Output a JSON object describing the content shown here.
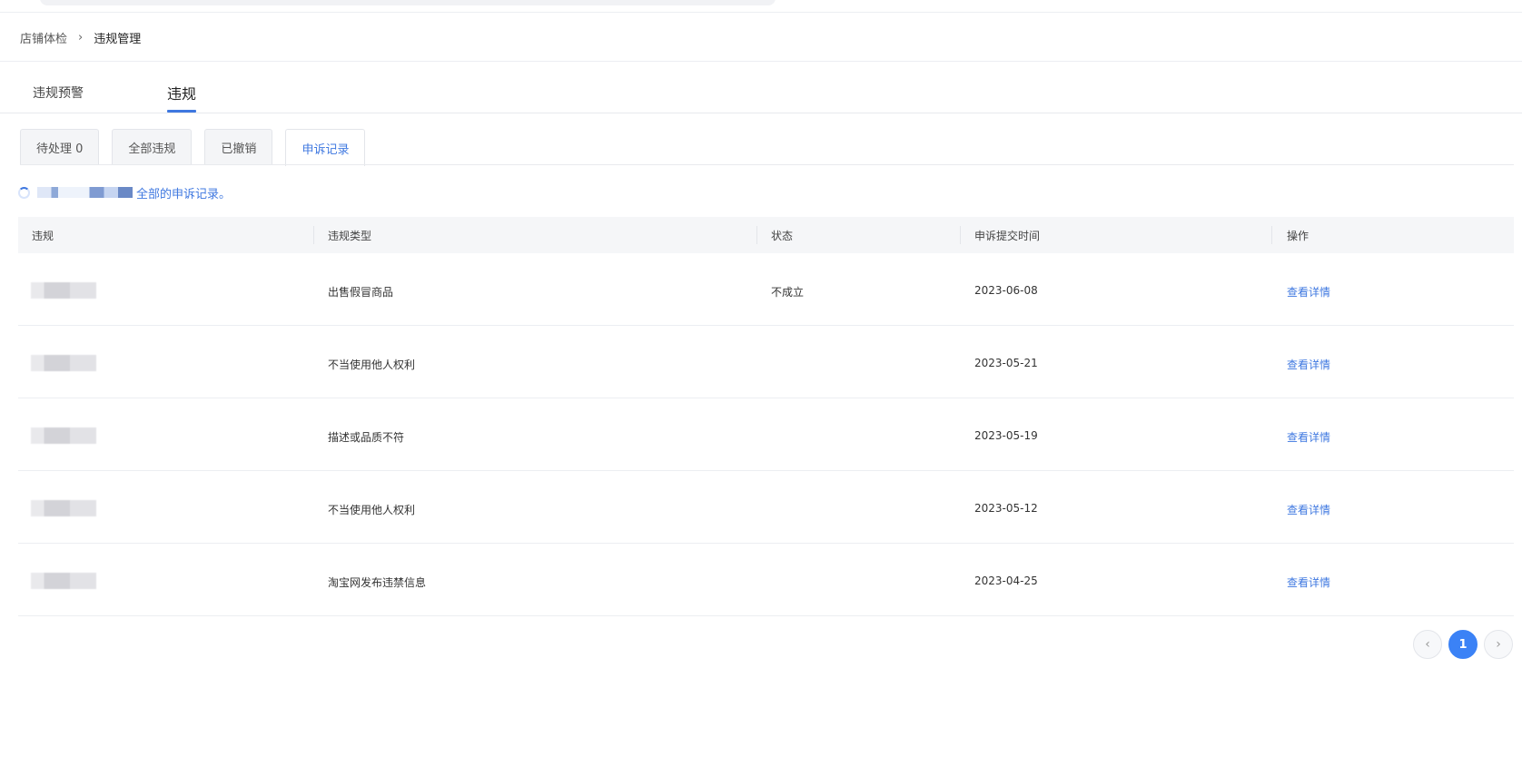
{
  "breadcrumb": {
    "parent": "店铺体检",
    "separator": "›",
    "current": "违规管理"
  },
  "main_tabs": [
    {
      "label": "违规预警"
    },
    {
      "label": "违规"
    }
  ],
  "sub_tabs": [
    {
      "label": "待处理 0"
    },
    {
      "label": "全部违规"
    },
    {
      "label": "已撤销"
    },
    {
      "label": "申诉记录"
    }
  ],
  "notice": {
    "text": "全部的申诉记录。"
  },
  "table": {
    "headers": [
      "违规",
      "违规类型",
      "状态",
      "申诉提交时间",
      "操作"
    ],
    "rows": [
      {
        "type": "出售假冒商品",
        "status": "不成立",
        "date": "2023-06-08",
        "action": "查看详情"
      },
      {
        "type": "不当使用他人权利",
        "status": "",
        "date": "2023-05-21",
        "action": "查看详情"
      },
      {
        "type": "描述或品质不符",
        "status": "",
        "date": "2023-05-19",
        "action": "查看详情"
      },
      {
        "type": "不当使用他人权利",
        "status": "",
        "date": "2023-05-12",
        "action": "查看详情"
      },
      {
        "type": "淘宝网发布违禁信息",
        "status": "",
        "date": "2023-04-25",
        "action": "查看详情"
      }
    ]
  },
  "pagination": {
    "prev": "‹",
    "current": "1",
    "next": "›"
  },
  "colors": {
    "accent": "#3f78e0",
    "page_active": "#3b82f6"
  }
}
